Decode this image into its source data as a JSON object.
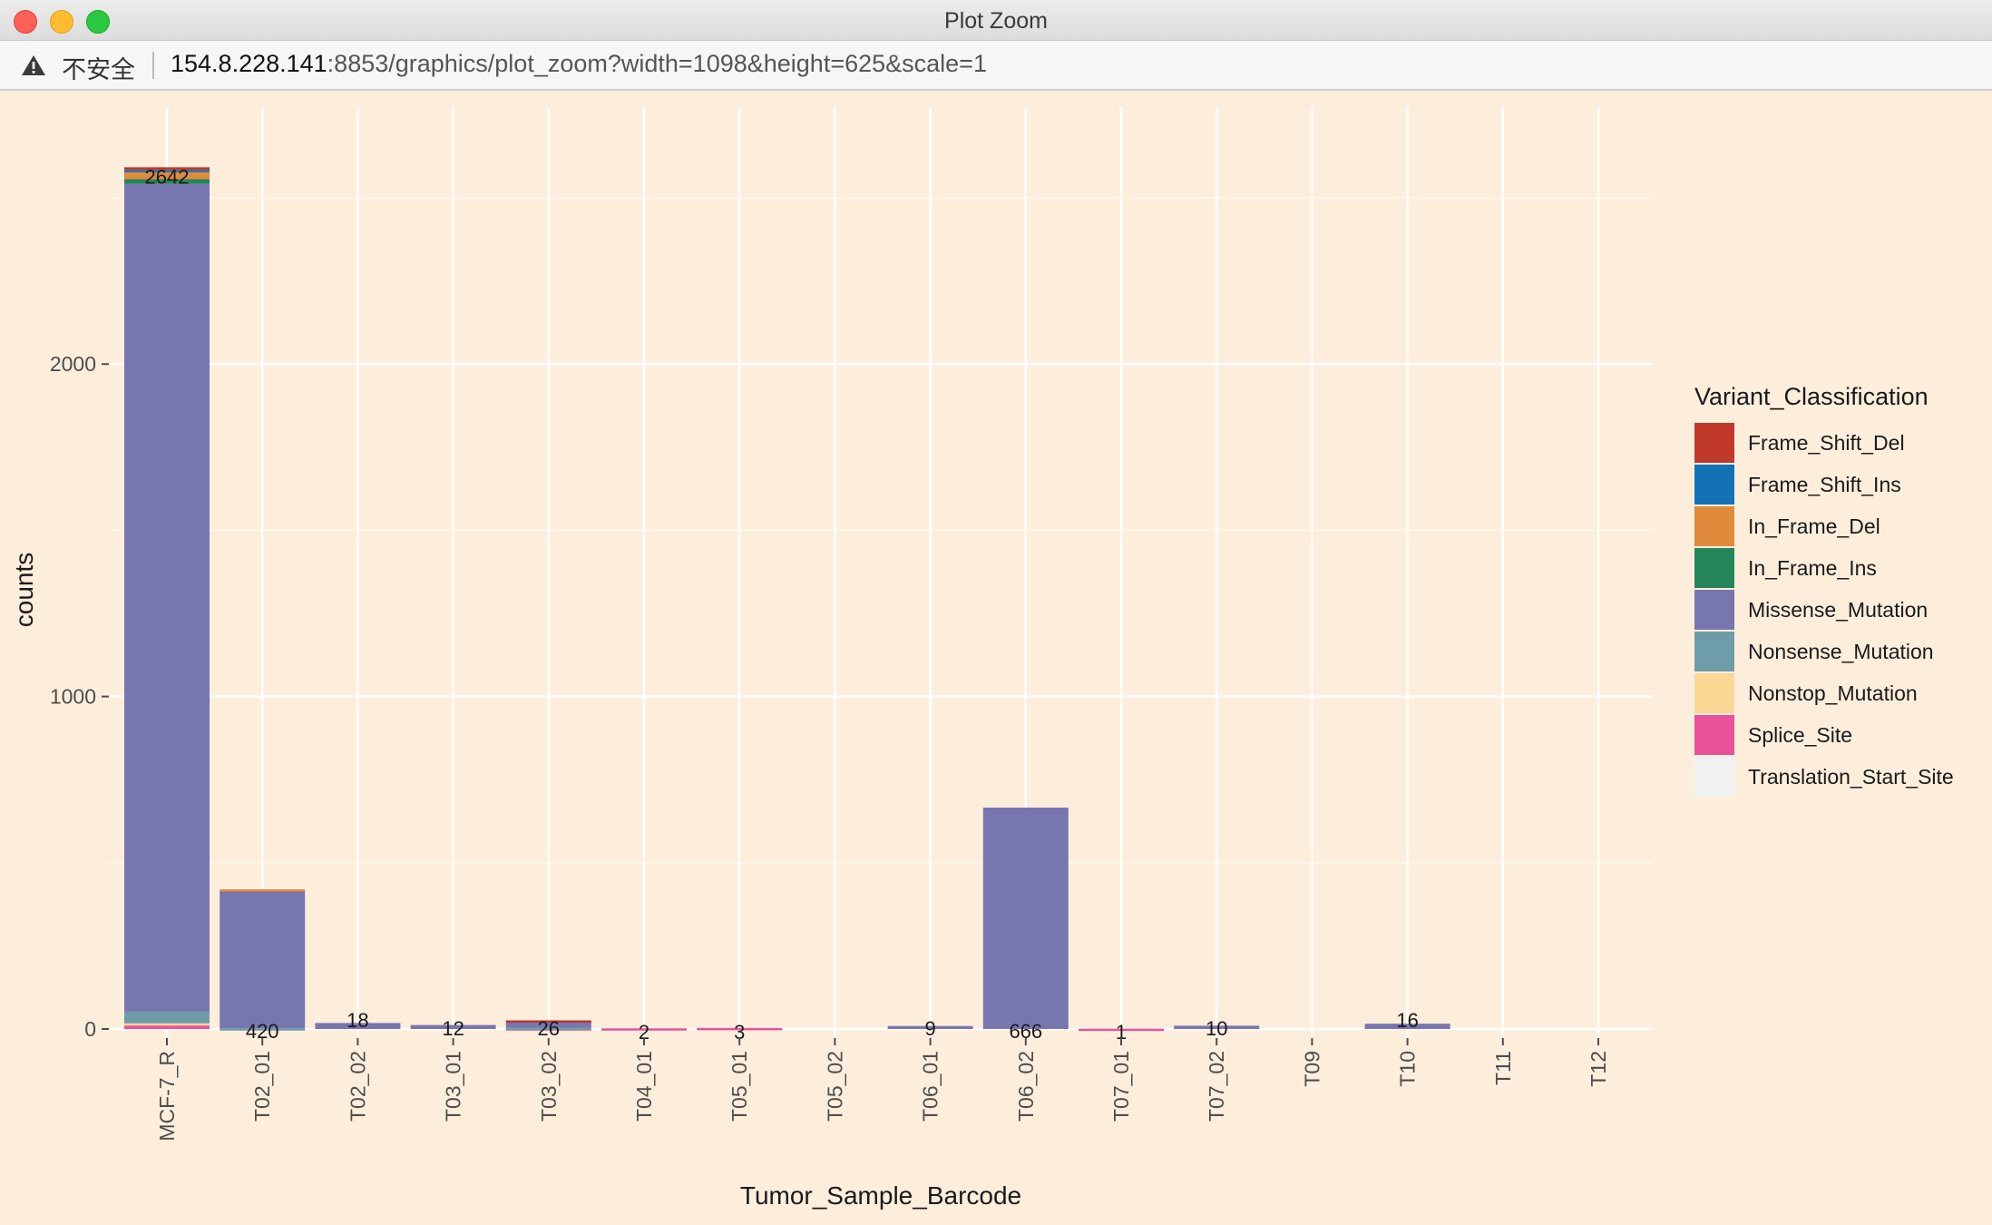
{
  "window": {
    "title": "Plot Zoom"
  },
  "urlbar": {
    "security_label": "不安全",
    "url_host": "154.8.228.141",
    "url_rest": ":8853/graphics/plot_zoom?width=1098&height=625&scale=1"
  },
  "chart_data": {
    "type": "bar",
    "stacked": true,
    "xlabel": "Tumor_Sample_Barcode",
    "ylabel": "counts",
    "ylim": [
      0,
      2642
    ],
    "yticks": [
      0,
      1000,
      2000
    ],
    "grid": true,
    "legend_position": "right",
    "legend_title": "Variant_Classification",
    "categories": [
      "MCF-7_R",
      "T02_01",
      "T02_02",
      "T03_01",
      "T03_02",
      "T04_01",
      "T05_01",
      "T05_02",
      "T06_01",
      "T06_02",
      "T07_01",
      "T07_02",
      "T09",
      "T10",
      "T11",
      "T12"
    ],
    "totals": [
      "2642",
      "420",
      "18",
      "12",
      "26",
      "2",
      "3",
      "",
      "9",
      "666",
      "1",
      "10",
      "",
      "16",
      "",
      ""
    ],
    "series": [
      {
        "name": "Frame_Shift_Del",
        "color": "#c0392b",
        "values": [
          8,
          0,
          0,
          0,
          2,
          0,
          0,
          0,
          0,
          0,
          0,
          0,
          0,
          0,
          0,
          0
        ]
      },
      {
        "name": "Frame_Shift_Ins",
        "color": "#1372b5",
        "values": [
          6,
          0,
          0,
          0,
          0,
          0,
          0,
          0,
          0,
          0,
          0,
          0,
          0,
          0,
          0,
          0
        ]
      },
      {
        "name": "In_Frame_Del",
        "color": "#e08a3c",
        "values": [
          22,
          2,
          0,
          0,
          0,
          0,
          0,
          0,
          0,
          0,
          0,
          0,
          0,
          0,
          0,
          0
        ]
      },
      {
        "name": "In_Frame_Ins",
        "color": "#25855a",
        "values": [
          14,
          0,
          0,
          0,
          0,
          0,
          0,
          0,
          0,
          0,
          0,
          0,
          0,
          0,
          0,
          0
        ]
      },
      {
        "name": "Missense_Mutation",
        "color": "#7876ae",
        "values": [
          2490,
          416,
          18,
          12,
          20,
          0,
          0,
          0,
          9,
          666,
          0,
          10,
          0,
          16,
          0,
          0
        ]
      },
      {
        "name": "Nonsense_Mutation",
        "color": "#6e9ca9",
        "values": [
          35,
          2,
          0,
          0,
          2,
          0,
          0,
          0,
          0,
          0,
          0,
          0,
          0,
          0,
          0,
          0
        ]
      },
      {
        "name": "Nonstop_Mutation",
        "color": "#fcd895",
        "values": [
          5,
          0,
          0,
          0,
          0,
          0,
          0,
          0,
          0,
          0,
          0,
          0,
          0,
          0,
          0,
          0
        ]
      },
      {
        "name": "Splice_Site",
        "color": "#e9529a",
        "values": [
          12,
          0,
          0,
          0,
          2,
          2,
          3,
          0,
          0,
          0,
          1,
          0,
          0,
          0,
          0,
          0
        ]
      },
      {
        "name": "Translation_Start_Site",
        "color": "#f2f2f2",
        "values": [
          0,
          0,
          0,
          0,
          0,
          0,
          0,
          0,
          0,
          0,
          0,
          0,
          0,
          0,
          0,
          0
        ]
      }
    ]
  }
}
